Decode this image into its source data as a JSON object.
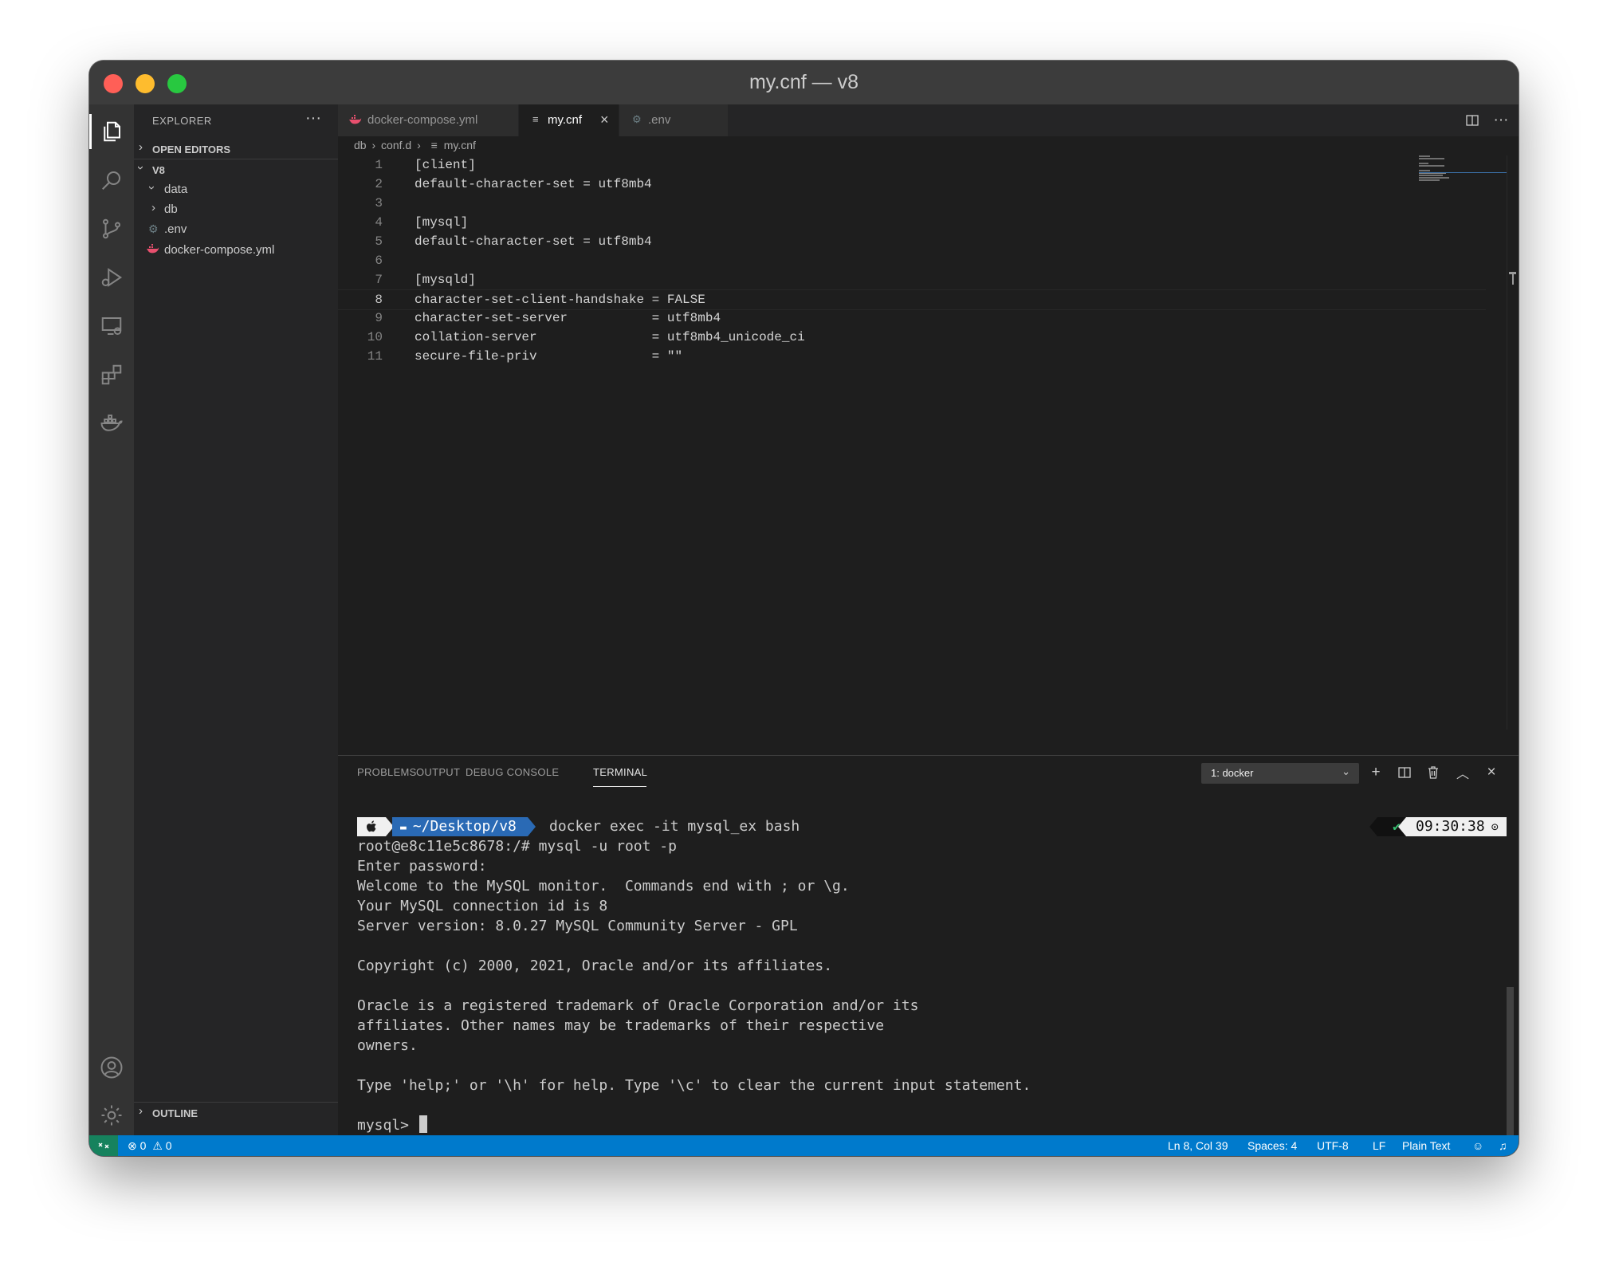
{
  "window": {
    "title": "my.cnf — v8"
  },
  "colors": {
    "close": "#ff5f57",
    "minimize": "#febc2e",
    "maximize": "#28c840",
    "statusbar": "#007acc",
    "accent": "#2a6ab5"
  },
  "activitybar": {
    "items": [
      {
        "icon": "files-icon"
      },
      {
        "icon": "search-icon"
      },
      {
        "icon": "source-control-icon"
      },
      {
        "icon": "run-debug-icon"
      },
      {
        "icon": "remote-explorer-icon"
      },
      {
        "icon": "extensions-icon"
      },
      {
        "icon": "docker-icon"
      }
    ],
    "bottom": [
      {
        "icon": "account-icon"
      },
      {
        "icon": "settings-gear-icon"
      }
    ]
  },
  "sidebar": {
    "title": "EXPLORER",
    "more": "···",
    "open_editors": "OPEN EDITORS",
    "folder": "V8",
    "tree": [
      {
        "label": "data",
        "type": "folder",
        "expanded": true
      },
      {
        "label": "db",
        "type": "folder",
        "expanded": false
      },
      {
        "label": ".env",
        "type": "file",
        "icon": "gear-icon"
      },
      {
        "label": "docker-compose.yml",
        "type": "file",
        "icon": "docker-icon"
      }
    ],
    "outline": "OUTLINE"
  },
  "tabs": [
    {
      "label": "docker-compose.yml",
      "icon": "docker-icon",
      "active": false
    },
    {
      "label": "my.cnf",
      "icon": "text-file-icon",
      "active": true,
      "close": "×"
    },
    {
      "label": ".env",
      "icon": "gear-icon",
      "active": false
    }
  ],
  "breadcrumb": {
    "parts": [
      "db",
      "conf.d",
      "my.cnf"
    ],
    "sep": "›"
  },
  "editor": {
    "current_line": 8,
    "lines": [
      {
        "n": "1",
        "text": "[client]"
      },
      {
        "n": "2",
        "text": "default-character-set = utf8mb4"
      },
      {
        "n": "3",
        "text": ""
      },
      {
        "n": "4",
        "text": "[mysql]"
      },
      {
        "n": "5",
        "text": "default-character-set = utf8mb4"
      },
      {
        "n": "6",
        "text": ""
      },
      {
        "n": "7",
        "text": "[mysqld]"
      },
      {
        "n": "8",
        "text": "character-set-client-handshake = FALSE"
      },
      {
        "n": "9",
        "text": "character-set-server           = utf8mb4"
      },
      {
        "n": "10",
        "text": "collation-server               = utf8mb4_unicode_ci"
      },
      {
        "n": "11",
        "text": "secure-file-priv               = \"\""
      }
    ]
  },
  "panel": {
    "tabs": [
      "PROBLEMS",
      "OUTPUT",
      "DEBUG CONSOLE",
      "TERMINAL"
    ],
    "active_tab": "TERMINAL",
    "terminal_select": "1: docker",
    "actions": [
      "new-terminal-icon",
      "split-terminal-icon",
      "trash-icon",
      "maximize-panel-icon",
      "close-panel-icon"
    ]
  },
  "terminal": {
    "prompt_path": "~/Desktop/v8",
    "command": "docker exec -it mysql_ex bash",
    "status_ok": "✔",
    "time": "09:30:38",
    "lines": [
      "root@e8c11e5c8678:/# mysql -u root -p",
      "Enter password:",
      "Welcome to the MySQL monitor.  Commands end with ; or \\g.",
      "Your MySQL connection id is 8",
      "Server version: 8.0.27 MySQL Community Server - GPL",
      "",
      "Copyright (c) 2000, 2021, Oracle and/or its affiliates.",
      "",
      "Oracle is a registered trademark of Oracle Corporation and/or its",
      "affiliates. Other names may be trademarks of their respective",
      "owners.",
      "",
      "Type 'help;' or '\\h' for help. Type '\\c' to clear the current input statement.",
      ""
    ],
    "input_prompt": "mysql> "
  },
  "statusbar": {
    "errors": "0",
    "warnings": "0",
    "position": "Ln 8, Col 39",
    "spaces": "Spaces: 4",
    "encoding": "UTF-8",
    "eol": "LF",
    "language": "Plain Text"
  }
}
